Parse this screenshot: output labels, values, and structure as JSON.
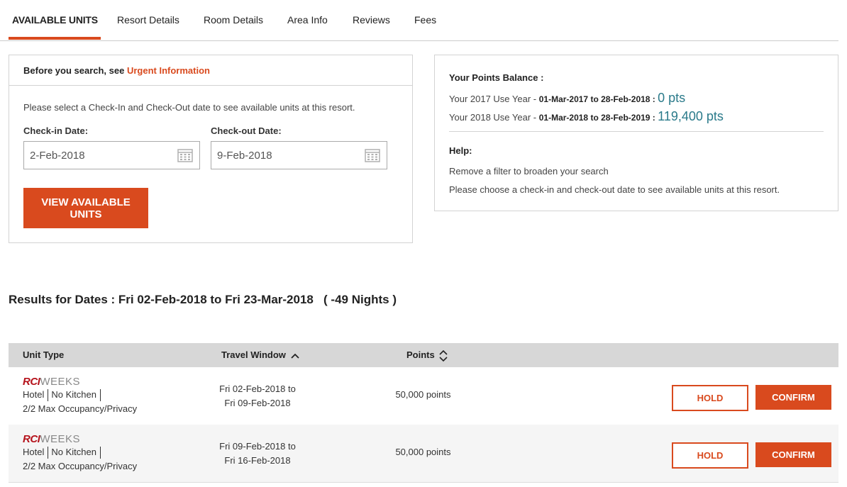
{
  "tabs": [
    {
      "label": "AVAILABLE UNITS",
      "active": true
    },
    {
      "label": "Resort Details"
    },
    {
      "label": "Room Details"
    },
    {
      "label": "Area Info"
    },
    {
      "label": "Reviews"
    },
    {
      "label": "Fees"
    }
  ],
  "search": {
    "notice_prefix": "Before you search, see ",
    "notice_link": "Urgent Information",
    "instruction": "Please select a Check-In and Check-Out date to see available units at this resort.",
    "checkin_label": "Check-in Date:",
    "checkin_value": "2-Feb-2018",
    "checkout_label": "Check-out Date:",
    "checkout_value": "9-Feb-2018",
    "view_button": "VIEW AVAILABLE UNITS"
  },
  "points": {
    "title": "Your Points Balance :",
    "years": [
      {
        "label": "Your 2017 Use Year - ",
        "range": "01-Mar-2017 to 28-Feb-2018 : ",
        "points": "0 pts"
      },
      {
        "label": "Your 2018 Use Year - ",
        "range": "01-Mar-2018 to 28-Feb-2019 : ",
        "points": "119,400 pts"
      }
    ],
    "help_title": "Help:",
    "help_lines": [
      "Remove a filter to broaden your search",
      "Please choose a check-in and check-out date to see available units at this resort."
    ]
  },
  "results": {
    "title": "Results for Dates : Fri 02-Feb-2018 to Fri 23-Mar-2018   ( -49 Nights )",
    "columns": {
      "unit_type": "Unit Type",
      "travel_window": "Travel Window",
      "points": "Points"
    },
    "rows": [
      {
        "brand_rci": "RCI",
        "brand_weeks": "WEEKS",
        "unit": "Hotel",
        "kitchen": "No Kitchen",
        "occupancy": "2/2 Max Occupancy/Privacy",
        "window_start": "Fri 02-Feb-2018 to",
        "window_end": "Fri 09-Feb-2018",
        "points": "50,000 points",
        "hold": "HOLD",
        "confirm": "CONFIRM"
      },
      {
        "brand_rci": "RCI",
        "brand_weeks": "WEEKS",
        "unit": "Hotel",
        "kitchen": "No Kitchen",
        "occupancy": "2/2 Max Occupancy/Privacy",
        "window_start": "Fri 09-Feb-2018 to",
        "window_end": "Fri 16-Feb-2018",
        "points": "50,000 points",
        "hold": "HOLD",
        "confirm": "CONFIRM"
      }
    ]
  },
  "colors": {
    "accent": "#d94a1e",
    "points_value": "#2a7a8a",
    "brand_rci": "#b5121b"
  },
  "icons": {
    "date": "calendar-icon",
    "sort_asc": "sort-up-icon",
    "sort_both": "sort-both-icon"
  }
}
